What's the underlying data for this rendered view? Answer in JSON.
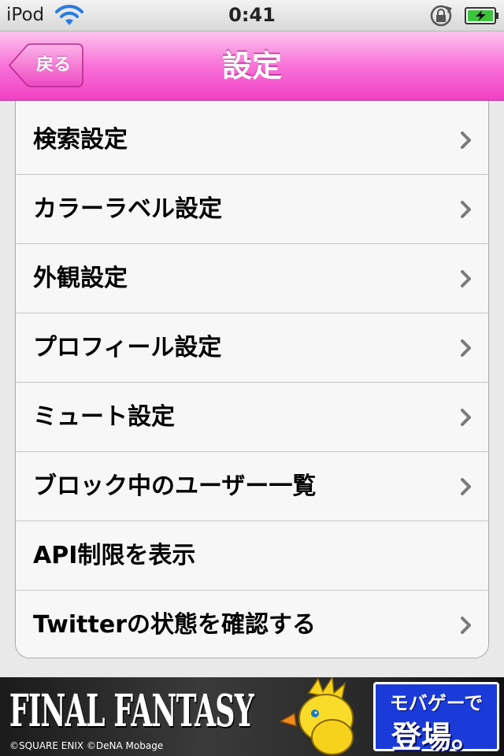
{
  "status_bar": {
    "carrier": "iPod",
    "time": "0:41",
    "icons": [
      "wifi-icon",
      "orientation-lock-icon",
      "battery-charging-icon"
    ]
  },
  "nav_bar": {
    "back_label": "戻る",
    "title": "設定",
    "color": "#f860d0"
  },
  "settings": {
    "items": [
      {
        "label": "検索設定",
        "chevron": true
      },
      {
        "label": "カラーラベル設定",
        "chevron": true
      },
      {
        "label": "外観設定",
        "chevron": true
      },
      {
        "label": "プロフィール設定",
        "chevron": true
      },
      {
        "label": "ミュート設定",
        "chevron": true
      },
      {
        "label": "ブロック中のユーザー一覧",
        "chevron": true
      },
      {
        "label": "API制限を表示",
        "chevron": false
      },
      {
        "label": "Twitterの状態を確認する",
        "chevron": true
      }
    ]
  },
  "ad": {
    "wordmark": "FINAL FANTASY",
    "copyright": "©SQUARE ENIX  ©DeNA    Mobage",
    "tagline_top": "モバゲーで",
    "tagline_bottom": "登場。",
    "accent_color": "#1a3bd8"
  }
}
